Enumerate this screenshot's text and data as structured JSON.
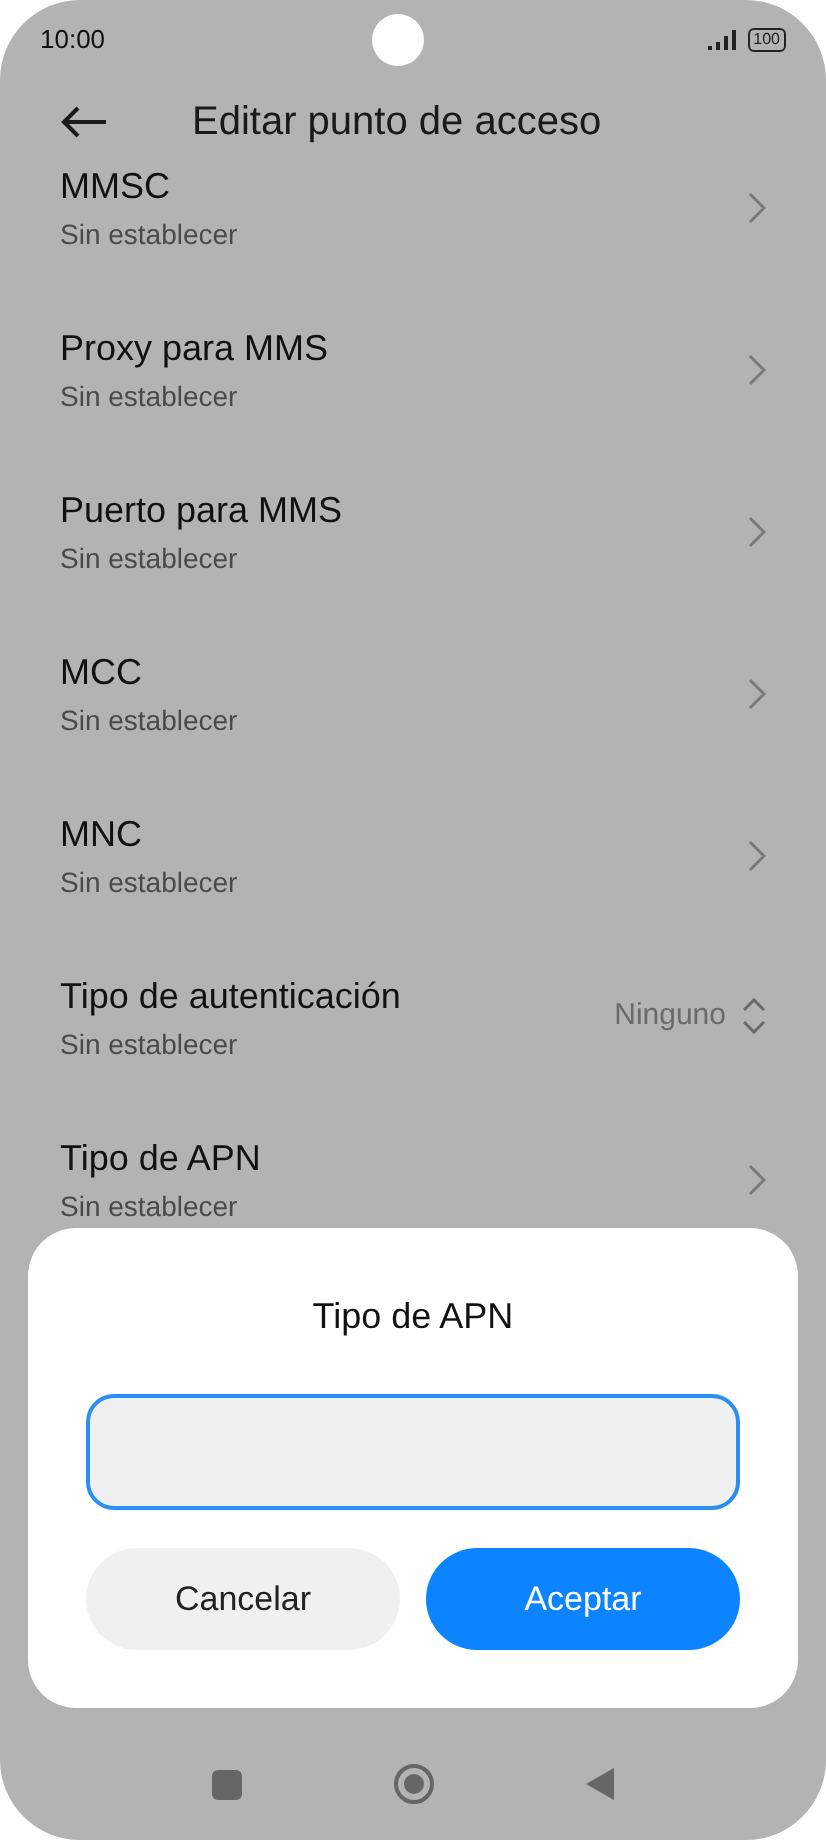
{
  "status_bar": {
    "time": "10:00",
    "battery": "100"
  },
  "header": {
    "title": "Editar punto de acceso"
  },
  "settings": [
    {
      "kind": "link",
      "title": "MMSC",
      "subtitle": "Sin establecer"
    },
    {
      "kind": "link",
      "title": "Proxy para MMS",
      "subtitle": "Sin establecer"
    },
    {
      "kind": "link",
      "title": "Puerto para MMS",
      "subtitle": "Sin establecer"
    },
    {
      "kind": "link",
      "title": "MCC",
      "subtitle": "Sin establecer"
    },
    {
      "kind": "link",
      "title": "MNC",
      "subtitle": "Sin establecer"
    },
    {
      "kind": "select",
      "title": "Tipo de autenticación",
      "subtitle": "Sin establecer",
      "value": "Ninguno"
    },
    {
      "kind": "link",
      "title": "Tipo de APN",
      "subtitle": "Sin establecer"
    }
  ],
  "dialog": {
    "title": "Tipo de APN",
    "field": {
      "focused": true
    },
    "buttons": [
      {
        "label": "Cancelar",
        "kind": "secondary"
      },
      {
        "label": "Aceptar",
        "kind": "primary"
      }
    ]
  }
}
